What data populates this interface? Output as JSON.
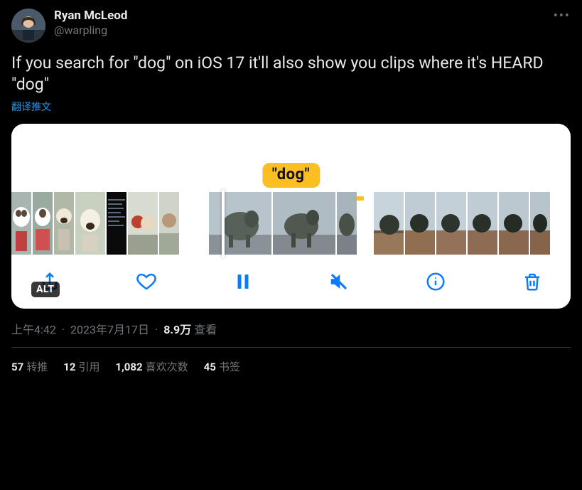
{
  "author": {
    "display_name": "Ryan McLeod",
    "handle": "@warpling"
  },
  "tweet_text": "If you search for \"dog\" on iOS 17 it'll also show you clips where it's HEARD \"dog\"",
  "translate_label": "翻译推文",
  "media": {
    "search_label": "\"dog\"",
    "alt_badge": "ALT"
  },
  "meta": {
    "time": "上午4:42",
    "date": "2023年7月17日",
    "views_count": "8.9万",
    "views_label": "查看"
  },
  "stats": {
    "retweets_count": "57",
    "retweets_label": "转推",
    "quotes_count": "12",
    "quotes_label": "引用",
    "likes_count": "1,082",
    "likes_label": "喜欢次数",
    "bookmarks_count": "45",
    "bookmarks_label": "书签"
  }
}
